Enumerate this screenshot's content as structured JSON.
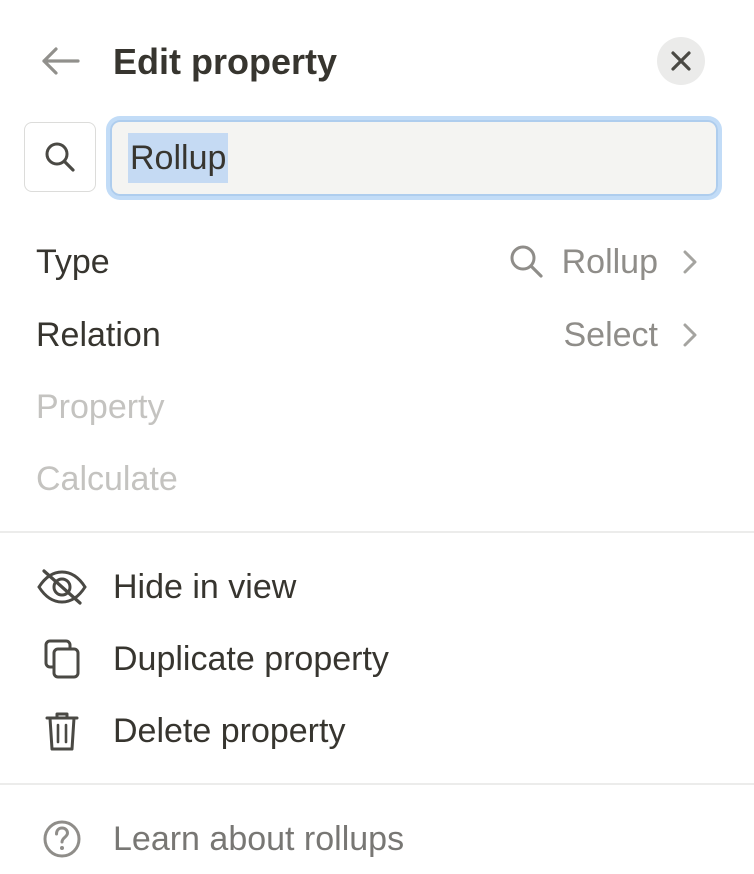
{
  "header": {
    "title": "Edit property",
    "back_icon": "arrow-left-icon",
    "close_icon": "close-icon"
  },
  "name_field": {
    "value": "Rollup",
    "icon": "search-icon"
  },
  "properties": {
    "type": {
      "label": "Type",
      "value": "Rollup",
      "icon": "search-icon"
    },
    "relation": {
      "label": "Relation",
      "value": "Select"
    },
    "property": {
      "label": "Property"
    },
    "calculate": {
      "label": "Calculate"
    }
  },
  "actions": {
    "hide": {
      "label": "Hide in view",
      "icon": "eye-off-icon"
    },
    "duplicate": {
      "label": "Duplicate property",
      "icon": "duplicate-icon"
    },
    "delete": {
      "label": "Delete property",
      "icon": "trash-icon"
    }
  },
  "help": {
    "label": "Learn about rollups",
    "icon": "help-circle-icon"
  },
  "colors": {
    "text": "#37352f",
    "muted": "#8f8d89",
    "disabled": "#c4c3c0",
    "focus": "#2383e2",
    "selection": "#c5daf3"
  }
}
